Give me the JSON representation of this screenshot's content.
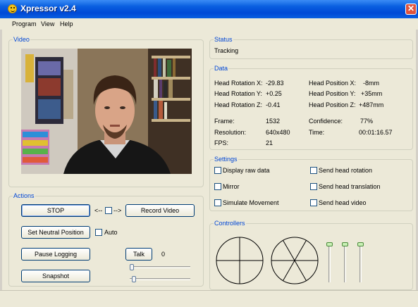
{
  "window": {
    "title": "Xpressor v2.4",
    "close_glyph": "✕"
  },
  "menu": [
    "Program",
    "View",
    "Help"
  ],
  "video": {
    "legend": "Video"
  },
  "actions": {
    "legend": "Actions",
    "stop": "STOP",
    "arrow_left": "<--",
    "arrow_right": "-->",
    "record": "Record Video",
    "set_neutral": "Set Neutral Position",
    "auto": "Auto",
    "pause_logging": "Pause Logging",
    "talk": "Talk",
    "talk_value": "0",
    "snapshot": "Snapshot",
    "slider1_level": 0.0,
    "slider2_level": 0.04
  },
  "status": {
    "legend": "Status",
    "value": "Tracking"
  },
  "data": {
    "legend": "Data",
    "head_rotation_x_label": "Head Rotation X:",
    "head_rotation_x": "-29.83",
    "head_rotation_y_label": "Head Rotation Y:",
    "head_rotation_y": "+0.25",
    "head_rotation_z_label": "Head Rotation Z:",
    "head_rotation_z": "-0.41",
    "head_position_x_label": "Head Position X:",
    "head_position_x": "-8mm",
    "head_position_y_label": "Head Position Y:",
    "head_position_y": "+35mm",
    "head_position_z_label": "Head Position Z:",
    "head_position_z": "+487mm",
    "frame_label": "Frame:",
    "frame": "1532",
    "resolution_label": "Resolution:",
    "resolution": "640x480",
    "fps_label": "FPS:",
    "fps": "21",
    "confidence_label": "Confidence:",
    "confidence": "77%",
    "time_label": "Time:",
    "time": "00:01:16.57"
  },
  "settings": {
    "legend": "Settings",
    "display_raw_data": "Display raw data",
    "mirror": "Mirror",
    "simulate_movement": "Simulate Movement",
    "send_head_rotation": "Send head rotation",
    "send_head_translation": "Send head translation",
    "send_head_video": "Send head video"
  },
  "controllers": {
    "legend": "Controllers",
    "slider_levels": [
      1.0,
      1.0,
      1.0
    ]
  },
  "colors": {
    "title_bar": "#0a5fe0",
    "legend_text": "#0046d5",
    "panel_bg": "#ece9d8"
  }
}
